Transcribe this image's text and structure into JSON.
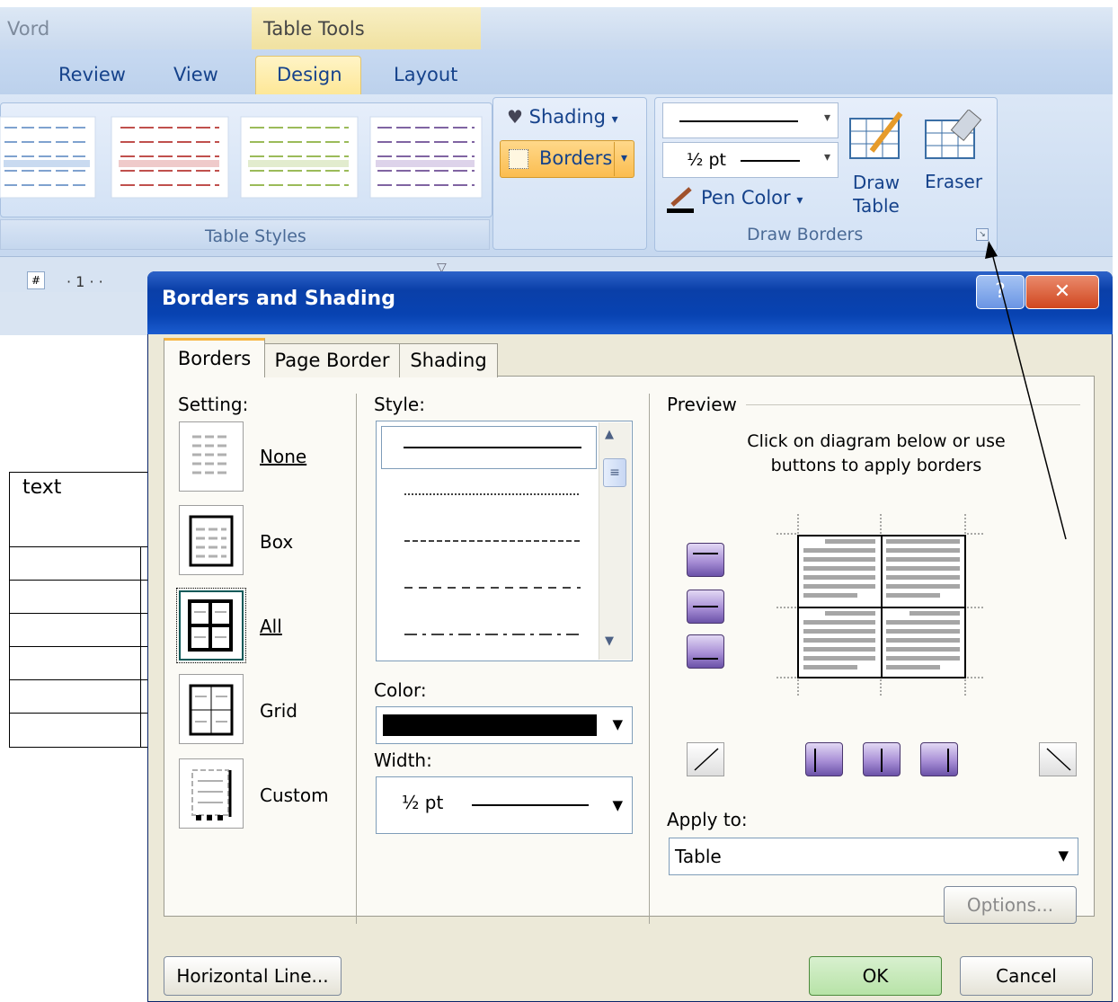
{
  "ribbon": {
    "app_title_fragment": "Vord",
    "context_title": "Table Tools",
    "tabs": [
      {
        "label": "Review"
      },
      {
        "label": "View"
      },
      {
        "label": "Design"
      },
      {
        "label": "Layout"
      }
    ],
    "groups": {
      "table_styles": {
        "label": "Table Styles"
      },
      "shading": {
        "label": "Shading",
        "arrow": "▾"
      },
      "borders": {
        "label": "Borders",
        "arrow": "▾"
      },
      "draw_borders": {
        "label": "Draw Borders",
        "line_width": "½ pt",
        "pen_color": "Pen Color",
        "draw_table": "Draw Table",
        "eraser": "Eraser"
      }
    }
  },
  "ruler": {
    "mark": "1"
  },
  "document": {
    "cell_text": "text"
  },
  "dialog": {
    "title": "Borders and Shading",
    "tabs": {
      "borders": "Borders",
      "page_border": "Page Border",
      "shading": "Shading"
    },
    "setting": {
      "label": "Setting:",
      "options": {
        "none": "None",
        "box": "Box",
        "all": "All",
        "grid": "Grid",
        "custom": "Custom"
      }
    },
    "style": {
      "label": "Style:"
    },
    "color": {
      "label": "Color:",
      "value": "#000000"
    },
    "width": {
      "label": "Width:",
      "value": "½ pt"
    },
    "preview": {
      "label": "Preview",
      "instruction_line1": "Click on diagram below or use",
      "instruction_line2": "buttons to apply borders"
    },
    "apply_to": {
      "label": "Apply to:",
      "value": "Table"
    },
    "options_button": "Options...",
    "horizontal_line_button": "Horizontal Line...",
    "ok_button": "OK",
    "cancel_button": "Cancel"
  },
  "colors": {
    "title_bar": "#0a3fa8",
    "dialog_bg": "#ece9d8",
    "ribbon_bg": "#c6d8ef",
    "accent_orange": "#fbbd50",
    "accent_purple": "#8a6fc4"
  }
}
